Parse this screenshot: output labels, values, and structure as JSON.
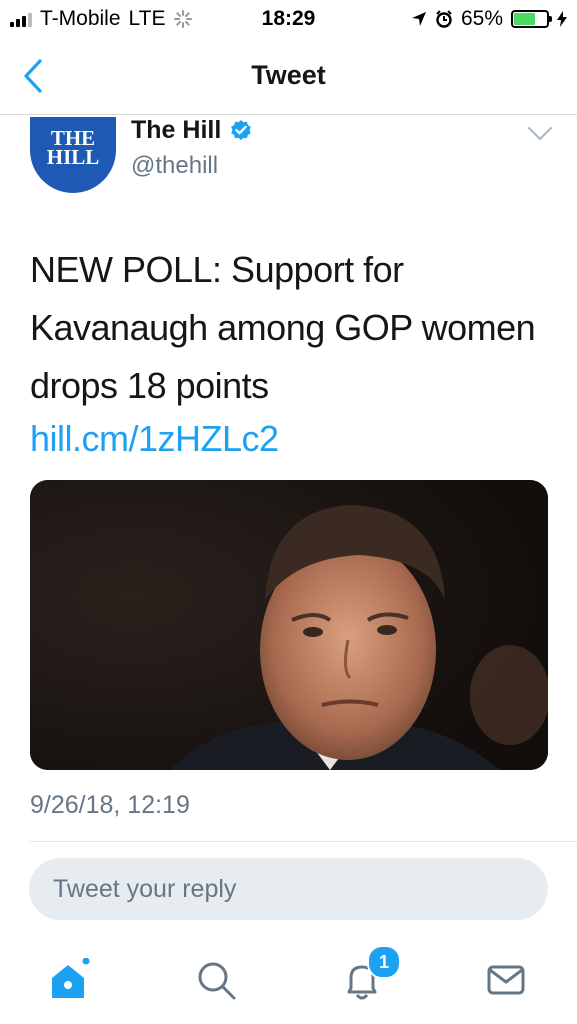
{
  "status_bar": {
    "carrier": "T-Mobile",
    "network": "LTE",
    "time": "18:29",
    "battery": "65%",
    "battery_level": 0.65
  },
  "nav": {
    "title": "Tweet"
  },
  "tweet": {
    "avatar_text_line1": "THE",
    "avatar_text_line2": "HILL",
    "author_name": "The Hill",
    "handle": "@thehill",
    "text": "NEW POLL: Support for Kavanaugh among GOP women drops 18 points",
    "link": "hill.cm/1zHZLc2",
    "timestamp": "9/26/18, 12:19"
  },
  "reply": {
    "placeholder": "Tweet your reply"
  },
  "tab_bar": {
    "notifications_badge": "1"
  },
  "colors": {
    "accent": "#1da1f2",
    "avatar": "#1e5ab4",
    "secondary_text": "#657786"
  }
}
